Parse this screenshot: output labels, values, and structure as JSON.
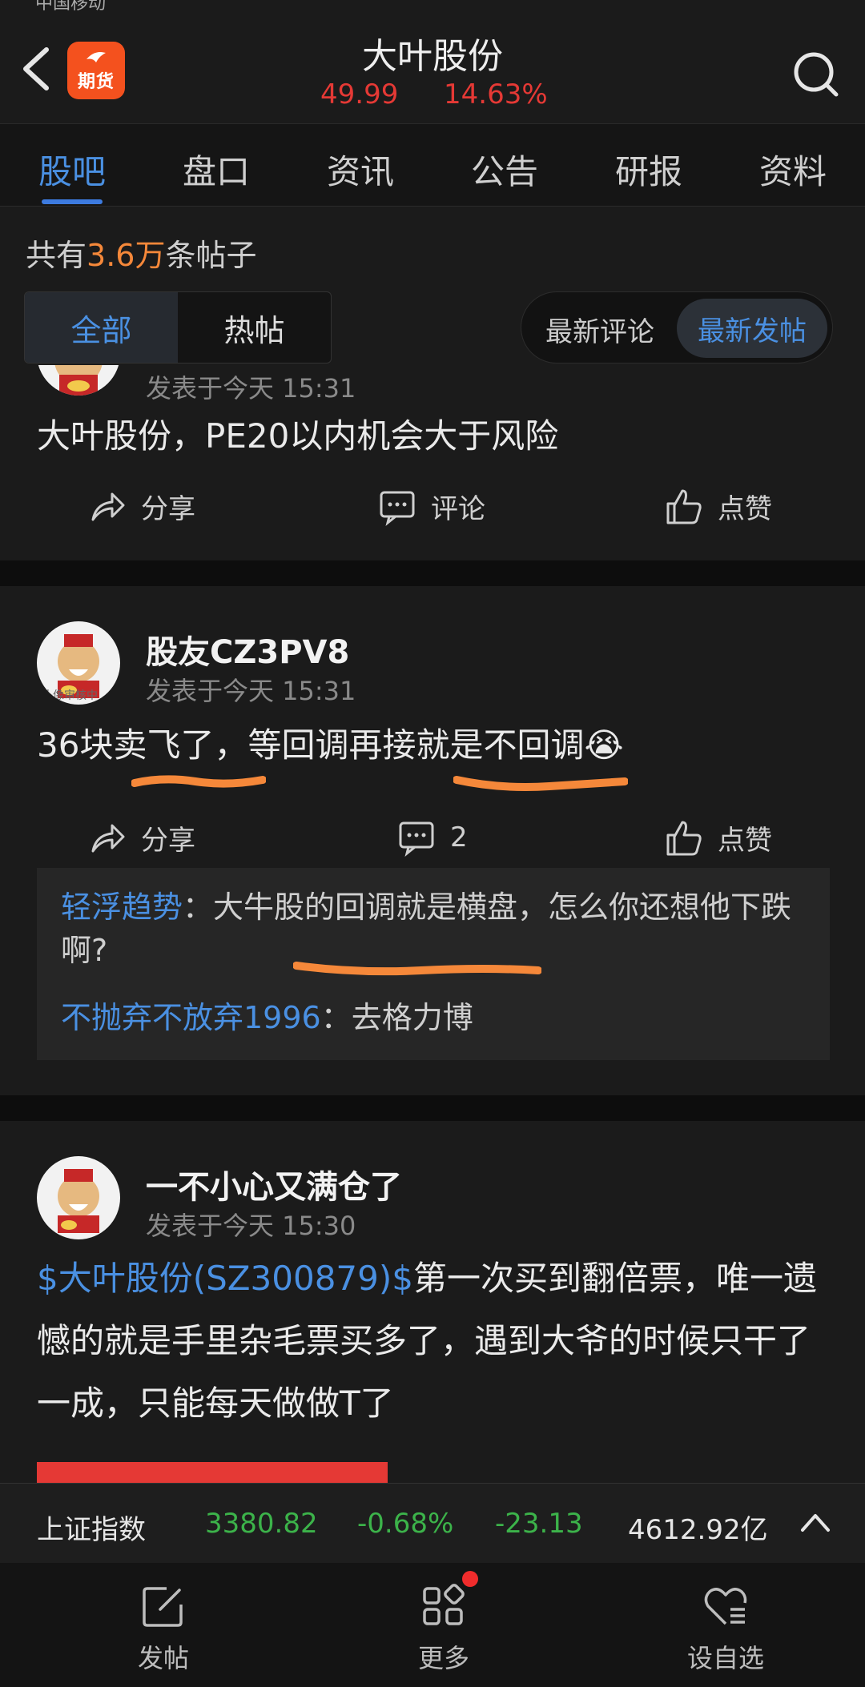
{
  "status_bar": {
    "carrier": "中国移动"
  },
  "header": {
    "title": "大叶股份",
    "price": "49.99",
    "change_pct": "14.63%",
    "futures_badge": "期货"
  },
  "tabs": [
    {
      "label": "股吧",
      "active": true
    },
    {
      "label": "盘口"
    },
    {
      "label": "资讯"
    },
    {
      "label": "公告"
    },
    {
      "label": "研报"
    },
    {
      "label": "资料"
    }
  ],
  "summary": {
    "prefix": "共有",
    "count": "3.6万",
    "suffix": "条帖子"
  },
  "filters": {
    "segment": [
      "全部",
      "热帖"
    ],
    "sort": [
      "最新评论",
      "最新发帖"
    ]
  },
  "posts": [
    {
      "time": "发表于今天 15:31",
      "content": "大叶股份，PE20以内机会大于风险",
      "actions": {
        "share": "分享",
        "comment": "评论",
        "like": "点赞"
      }
    },
    {
      "user": "股友CZ3PV8",
      "time": "发表于今天 15:31",
      "avatar_caption": "头像审核中",
      "content": "36块卖飞了，等回调再接就是不回调😭",
      "actions": {
        "share": "分享",
        "comment": "2",
        "like": "点赞"
      },
      "replies": [
        {
          "user": "轻浮趋势",
          "text": "：大牛股的回调就是横盘，怎么你还想他下跌啊?"
        },
        {
          "user": "不抛弃不放弃1996",
          "text": "：去格力博"
        }
      ]
    },
    {
      "user": "一不小心又满仓了",
      "time": "发表于今天 15:30",
      "content_link": "$大叶股份(SZ300879)$",
      "content": "第一次买到翻倍票，唯一遗憾的就是手里杂毛票买多了，遇到大爷的时候只干了一成，只能每天做做T了"
    }
  ],
  "index_bar": {
    "name": "上证指数",
    "value": "3380.82",
    "pct": "-0.68%",
    "change": "-23.13",
    "turnover": "4612.92亿"
  },
  "bottom_nav": [
    {
      "label": "发帖",
      "icon": "edit-icon"
    },
    {
      "label": "更多",
      "icon": "grid-icon"
    },
    {
      "label": "设自选",
      "icon": "heart-list-icon"
    }
  ],
  "colors": {
    "accent": "#4a90e2",
    "up": "#e53935",
    "down": "#3cb34a",
    "highlight": "#f5883a"
  }
}
